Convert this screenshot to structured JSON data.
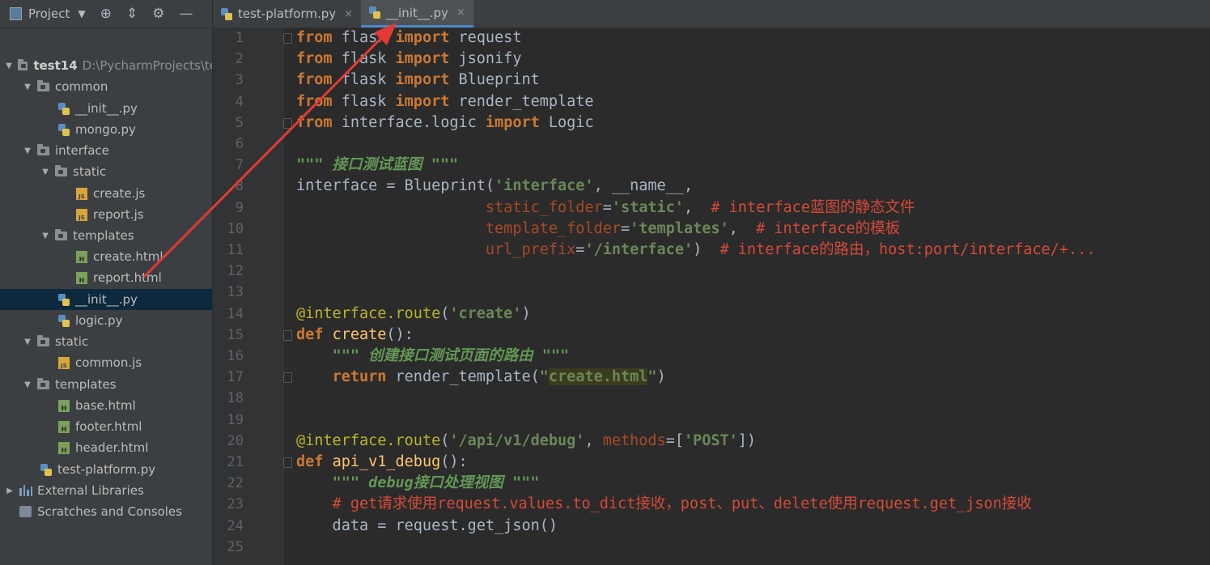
{
  "sidebar": {
    "title": "Project",
    "tree": [
      {
        "label": "test14",
        "path": "D:\\PycharmProjects\\te",
        "type": "folder",
        "bold": true,
        "arrow": "▼"
      },
      {
        "label": "common",
        "type": "folder",
        "arrow": "▼"
      },
      {
        "label": "__init__.py",
        "type": "py"
      },
      {
        "label": "mongo.py",
        "type": "py"
      },
      {
        "label": "interface",
        "type": "folder",
        "arrow": "▼"
      },
      {
        "label": "static",
        "type": "folder",
        "arrow": "▼"
      },
      {
        "label": "create.js",
        "type": "js"
      },
      {
        "label": "report.js",
        "type": "js"
      },
      {
        "label": "templates",
        "type": "folder",
        "arrow": "▼"
      },
      {
        "label": "create.html",
        "type": "html"
      },
      {
        "label": "report.html",
        "type": "html"
      },
      {
        "label": "__init__.py",
        "type": "py",
        "selected": true
      },
      {
        "label": "logic.py",
        "type": "py"
      },
      {
        "label": "static",
        "type": "folder",
        "arrow": "▼"
      },
      {
        "label": "common.js",
        "type": "js"
      },
      {
        "label": "templates",
        "type": "folder",
        "arrow": "▼"
      },
      {
        "label": "base.html",
        "type": "html"
      },
      {
        "label": "footer.html",
        "type": "html"
      },
      {
        "label": "header.html",
        "type": "html"
      },
      {
        "label": "test-platform.py",
        "type": "py"
      },
      {
        "label": "External Libraries",
        "type": "lib",
        "arrow": "▶"
      },
      {
        "label": "Scratches and Consoles",
        "type": "scratch"
      }
    ]
  },
  "tabs": [
    {
      "label": "test-platform.py",
      "active": false
    },
    {
      "label": "__init__.py",
      "active": true
    }
  ],
  "code_lines": [
    {
      "n": "1",
      "html": "<span class='kw'>from</span> flask <span class='kw'>import</span> request"
    },
    {
      "n": "2",
      "html": "<span class='kw'>from</span> flask <span class='kw'>import</span> jsonify"
    },
    {
      "n": "3",
      "html": "<span class='kw'>from</span> flask <span class='kw'>import</span> Blueprint"
    },
    {
      "n": "4",
      "html": "<span class='kw'>from</span> flask <span class='kw'>import</span> render_template"
    },
    {
      "n": "5",
      "html": "<span class='kw'>from</span> interface.logic <span class='kw'>import</span> Logic"
    },
    {
      "n": "6",
      "html": ""
    },
    {
      "n": "7",
      "html": "<span class='doc'>\"\"\" 接口测试蓝图 \"\"\"</span>"
    },
    {
      "n": "8",
      "html": "interface = Blueprint(<span class='str'>'interface'</span>, __name__,"
    },
    {
      "n": "9",
      "html": "                     <span class='param'>static_folder</span>=<span class='str'>'static'</span>,  <span class='cmt'># interface蓝图的静态文件</span>"
    },
    {
      "n": "10",
      "html": "                     <span class='param'>template_folder</span>=<span class='str'>'templates'</span>,  <span class='cmt'># interface的模板</span>"
    },
    {
      "n": "11",
      "html": "                     <span class='param'>url_prefix</span>=<span class='str'>'/interface'</span>)  <span class='cmt'># interface的路由，host:port/interface/+...</span>"
    },
    {
      "n": "12",
      "html": ""
    },
    {
      "n": "13",
      "html": ""
    },
    {
      "n": "14",
      "html": "<span class='deco'>@interface.route</span>(<span class='str'>'create'</span>)"
    },
    {
      "n": "15",
      "html": "<span class='kw'>def</span> <span class='fn'>create</span>():"
    },
    {
      "n": "16",
      "html": "    <span class='doc'>\"\"\" 创建接口测试页面的路由 \"\"\"</span>"
    },
    {
      "n": "17",
      "html": "    <span class='kw'>return</span> render_template(<span class='str'>\"<span class='hl'>create.html</span>\"</span>)"
    },
    {
      "n": "18",
      "html": ""
    },
    {
      "n": "19",
      "html": ""
    },
    {
      "n": "20",
      "html": "<span class='deco'>@interface.route</span>(<span class='str'>'/api/v1/debug'</span>, <span class='param'>methods</span>=[<span class='str'>'POST'</span>])"
    },
    {
      "n": "21",
      "html": "<span class='kw'>def</span> <span class='fn'>api_v1_debug</span>():"
    },
    {
      "n": "22",
      "html": "    <span class='doc'>\"\"\" debug接口处理视图 \"\"\"</span>"
    },
    {
      "n": "23",
      "html": "    <span class='cmt'># get请求使用request.values.to_dict接收，post、put、delete使用request.get_json接收</span>"
    },
    {
      "n": "24",
      "html": "    data = request.get_json()"
    },
    {
      "n": "25",
      "html": ""
    }
  ],
  "colors": {
    "arrow": "#e53935",
    "selection": "#0d293e",
    "tab_underline": "#4a88c7"
  }
}
